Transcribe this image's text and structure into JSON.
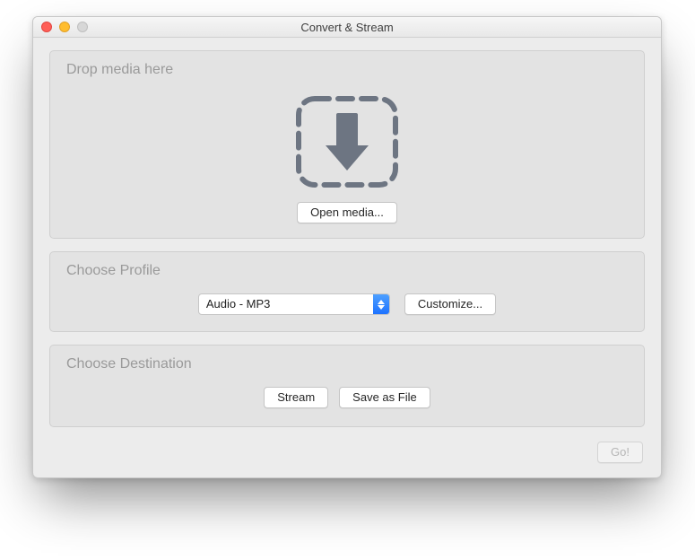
{
  "window": {
    "title": "Convert & Stream"
  },
  "drop": {
    "title": "Drop media here",
    "open_btn": "Open media..."
  },
  "profile": {
    "title": "Choose Profile",
    "selected": "Audio - MP3",
    "customize_btn": "Customize..."
  },
  "destination": {
    "title": "Choose Destination",
    "stream_btn": "Stream",
    "save_btn": "Save as File"
  },
  "footer": {
    "go_btn": "Go!"
  }
}
